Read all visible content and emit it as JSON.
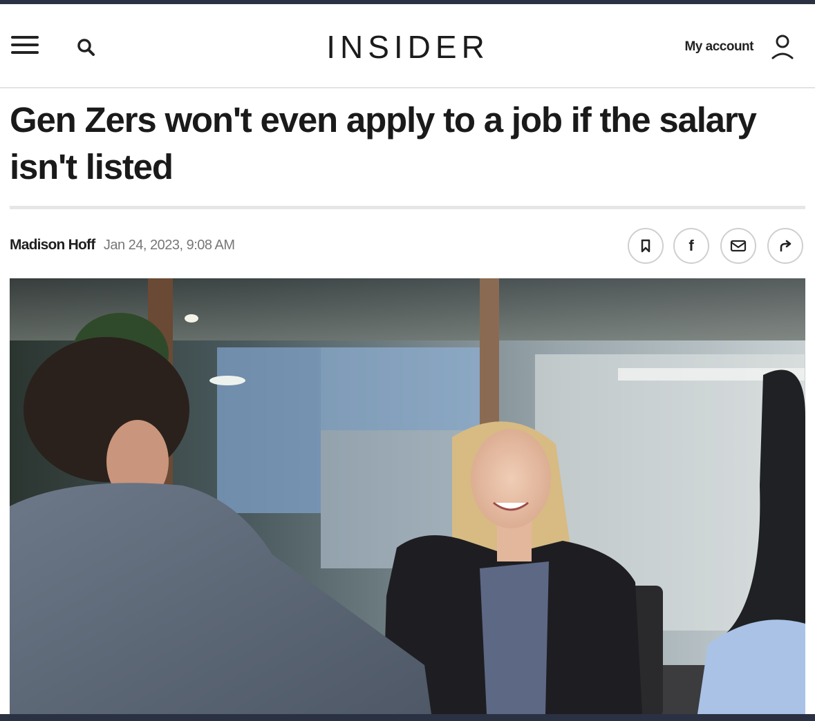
{
  "header": {
    "menu_icon": "hamburger-menu-icon",
    "search_icon": "search-icon",
    "logo": "INSIDER",
    "account_label": "My account",
    "account_icon": "user-icon"
  },
  "article": {
    "headline": "Gen Zers won't even apply to a job if the salary isn't listed",
    "author": "Madison Hoff",
    "date": "Jan 24, 2023, 9:08 AM",
    "share_buttons": [
      {
        "icon": "bookmark-icon"
      },
      {
        "icon": "facebook-icon",
        "label": "f"
      },
      {
        "icon": "email-icon"
      },
      {
        "icon": "share-arrow-icon"
      }
    ],
    "hero_image": "photo of a job interview: smiling blonde woman in black blazer seated across a table from a man in grey suit"
  },
  "colors": {
    "frame": "#2a3142",
    "text": "#1a1a1a",
    "meta": "#777777",
    "divider": "#e6e6e6"
  }
}
